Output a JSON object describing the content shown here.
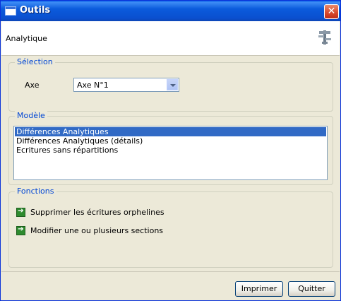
{
  "window": {
    "title": "Outils",
    "close_glyph": "✕"
  },
  "header": {
    "label": "Analytique",
    "icon": "tools-icon"
  },
  "selection": {
    "legend": "Sélection",
    "axe_label": "Axe",
    "axe_value": "Axe N°1"
  },
  "modele": {
    "legend": "Modèle",
    "items": [
      {
        "label": "Différences Analytiques",
        "selected": true
      },
      {
        "label": "Différences Analytiques (détails)",
        "selected": false
      },
      {
        "label": "Ecritures sans répartitions",
        "selected": false
      }
    ]
  },
  "fonctions": {
    "legend": "Fonctions",
    "items": [
      {
        "label": "Supprimer les écritures orphelines",
        "icon": "green-arrow-icon"
      },
      {
        "label": "Modifier une ou plusieurs sections",
        "icon": "green-arrow-icon"
      }
    ]
  },
  "footer": {
    "print_label": "Imprimer",
    "quit_label": "Quitter"
  },
  "colors": {
    "titlebar": "#0b5bdc",
    "legend": "#0046d5",
    "selection": "#316ac5",
    "arrow": "#2e8b2e"
  }
}
